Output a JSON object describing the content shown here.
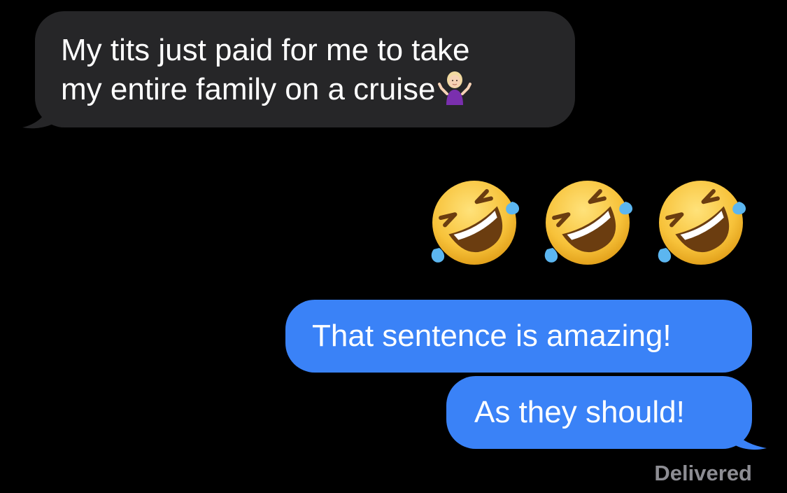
{
  "conversation": {
    "incoming": {
      "line1": "My tits just paid for me to take",
      "line2": "my entire family on a cruise",
      "emoji_icon": "person-shrugging-icon",
      "bubble_color": "#262628"
    },
    "reaction_emojis": [
      "rolling-on-floor-laughing-icon",
      "rolling-on-floor-laughing-icon",
      "rolling-on-floor-laughing-icon"
    ],
    "outgoing": [
      {
        "text": "That sentence is amazing!"
      },
      {
        "text": "As they should!"
      }
    ],
    "outgoing_color": "#3a82f7",
    "status": "Delivered"
  }
}
